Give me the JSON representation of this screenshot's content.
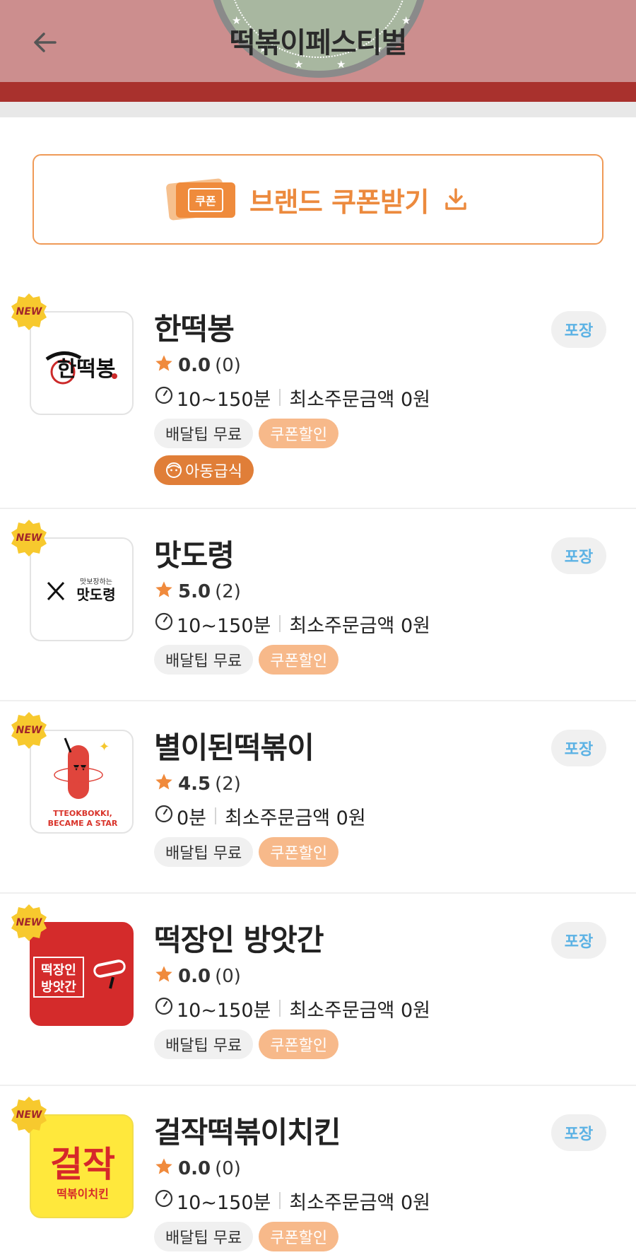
{
  "header": {
    "title": "떡볶이페스티벌",
    "back_icon": "arrow-left-icon",
    "bg_color": "#cc8e8e",
    "strip_color": "#a9312d"
  },
  "coupon_banner": {
    "ticket_label": "쿠폰",
    "label": "브랜드 쿠폰받기",
    "icon": "download-icon",
    "accent_color": "#ec8a3e"
  },
  "stores": [
    {
      "name": "한떡봉",
      "badge": "NEW",
      "rating": "0.0",
      "review_count": "(0)",
      "delivery_time": "10~150분",
      "min_order": "최소주문금액 0원",
      "tags": [
        "배달팁 무료",
        "쿠폰할인"
      ],
      "extra_tag": "아동급식",
      "pickup": "포장",
      "logo_text": "한떡봉"
    },
    {
      "name": "맛도령",
      "badge": "NEW",
      "rating": "5.0",
      "review_count": "(2)",
      "delivery_time": "10~150분",
      "min_order": "최소주문금액 0원",
      "tags": [
        "배달팁 무료",
        "쿠폰할인"
      ],
      "pickup": "포장",
      "logo_small": "맛보장하는",
      "logo_text": "맛도령"
    },
    {
      "name": "별이된떡볶이",
      "badge": "NEW",
      "rating": "4.5",
      "review_count": "(2)",
      "delivery_time": "0분",
      "min_order": "최소주문금액 0원",
      "tags": [
        "배달팁 무료",
        "쿠폰할인"
      ],
      "pickup": "포장",
      "logo_line1": "TTEOKBOKKI,",
      "logo_line2": "BECAME A STAR"
    },
    {
      "name": "떡장인 방앗간",
      "badge": "NEW",
      "rating": "0.0",
      "review_count": "(0)",
      "delivery_time": "10~150분",
      "min_order": "최소주문금액 0원",
      "tags": [
        "배달팁 무료",
        "쿠폰할인"
      ],
      "pickup": "포장",
      "logo_line1": "떡장인",
      "logo_line2": "방앗간"
    },
    {
      "name": "걸작떡볶이치킨",
      "badge": "NEW",
      "rating": "0.0",
      "review_count": "(0)",
      "delivery_time": "10~150분",
      "min_order": "최소주문금액 0원",
      "tags": [
        "배달팁 무료",
        "쿠폰할인"
      ],
      "pickup": "포장",
      "logo_big": "걸작",
      "logo_small": "떡볶이치킨"
    }
  ]
}
